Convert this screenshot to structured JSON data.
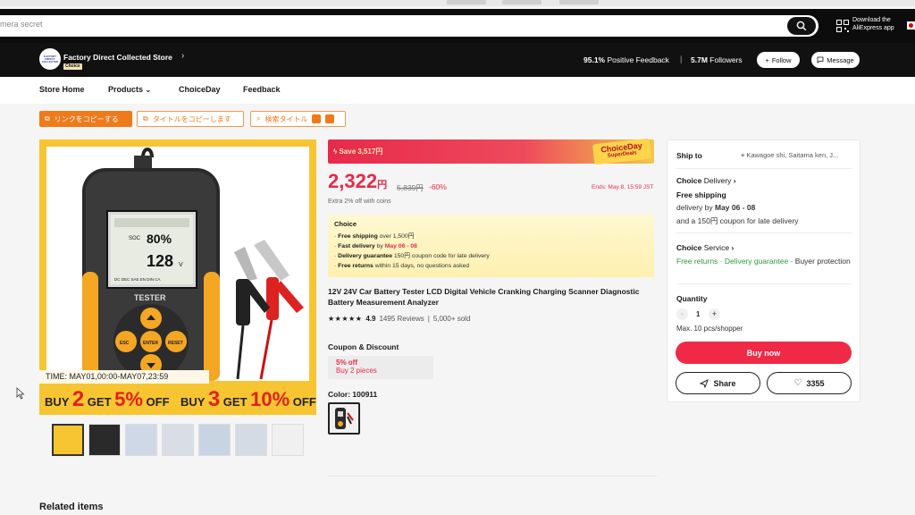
{
  "search": {
    "placeholder_text": "mera secret"
  },
  "header": {
    "download_line1": "Download the",
    "download_line2": "AliExpress app"
  },
  "store": {
    "logo_text": "FACTORY DIRECT COLLECTED",
    "choice_badge": "Choice",
    "name": "Factory Direct Collected Store",
    "feedback_pct": "95.1%",
    "feedback_label": "Positive Feedback",
    "followers_count": "5.7M",
    "followers_label": "Followers",
    "follow_label": "Follow",
    "message_label": "Message"
  },
  "nav": {
    "items": [
      "Store Home",
      "Products",
      "ChoiceDay",
      "Feedback"
    ]
  },
  "translate": {
    "copy_link": "リンクをコピーする",
    "copy_title": "タイトルをコピーします",
    "search_title": "検索タイトル"
  },
  "gallery": {
    "product_label": "TESTER",
    "screen_soc": "SOC",
    "screen_pct": "80%",
    "screen_volts": "128",
    "screen_v": "V",
    "screen_bottom": "DC DEC SAE EN DIN CA",
    "key_esc": "ESC",
    "key_enter": "ENTER",
    "key_reset": "RESET",
    "time_text": "TIME:  MAY01,00:00-MAY07,23:59",
    "promo1_a": "BUY ",
    "promo1_b": "2",
    "promo1_c": " GET ",
    "promo1_d": "5%",
    "promo1_e": " OFF",
    "promo2_a": "BUY ",
    "promo2_b": "3",
    "promo2_c": " GET ",
    "promo2_d": "10%",
    "promo2_e": " OFF"
  },
  "deal": {
    "save_text": "Save 3,517円",
    "choiceday_1": "ChoiceDay",
    "choiceday_2": "SuperDeals"
  },
  "price": {
    "value": "2,322",
    "currency": "円",
    "old": "5,839円",
    "discount": "-60%",
    "ends": "Ends: May 8, 15:59 JST",
    "extra": "Extra 2% off with coins"
  },
  "choice_box": {
    "heading": "Choice",
    "l1_b": "Free shipping",
    "l1_t": " over 1,500円",
    "l2_b": "Fast delivery",
    "l2_t": " by ",
    "l2_r": "May 06 - 08",
    "l3_b": "Delivery guarantee",
    "l3_t": "  150円 coupon code for late delivery",
    "l4_b": "Free returns",
    "l4_t": "  within 15 days, no questions asked"
  },
  "product": {
    "title": "12V 24V Car Battery Tester LCD Digital Vehicle Cranking Charging Scanner Diagnostic Battery Measurement Analyzer",
    "stars": "★★★★★",
    "rating": "4.9",
    "reviews": "1495 Reviews",
    "sold": "5,000+ sold"
  },
  "coupon": {
    "heading": "Coupon & Discount",
    "off": "5% off",
    "cond": "Buy 2 pieces"
  },
  "color": {
    "heading": "Color: 100911"
  },
  "related": {
    "heading": "Related items"
  },
  "panel": {
    "ship_to": "Ship to",
    "location": "Kawagoe shi, Saitama ken, J...",
    "choice_delivery_b": "Choice",
    "choice_delivery_t": " Delivery",
    "free_shipping": "Free shipping",
    "delivery_by": "delivery by ",
    "delivery_dates": "May 06 - 08",
    "coupon_note": "and a 150円 coupon for late delivery",
    "choice_service_b": "Choice",
    "choice_service_t": " Service",
    "free_returns": "Free returns",
    "dot": " · ",
    "delivery_guarantee": "Delivery guarantee",
    "buyer_protection": " · Buyer protection",
    "quantity_label": "Quantity",
    "qty_minus": "-",
    "qty_value": "1",
    "qty_plus": "+",
    "max_note": "Max. 10 pcs/shopper",
    "buy_now": "Buy now",
    "share": "Share",
    "wish_count": "3355"
  }
}
